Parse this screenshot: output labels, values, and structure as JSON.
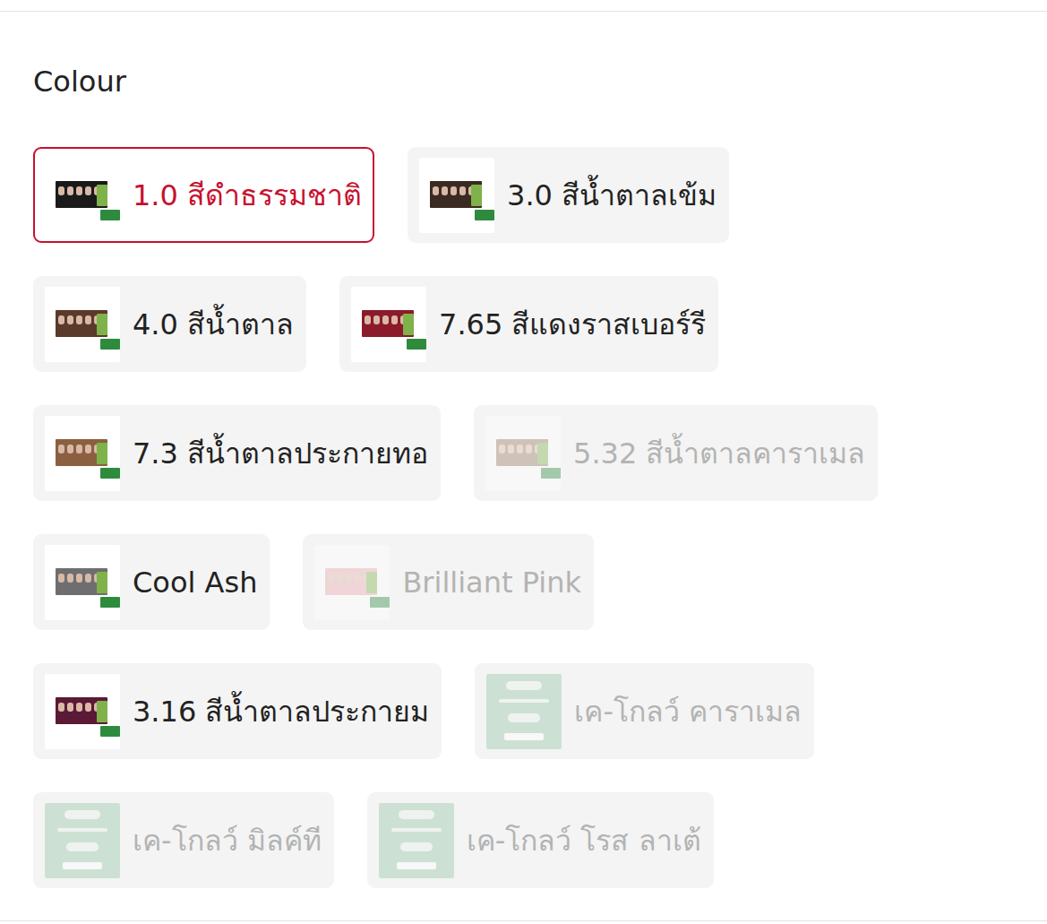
{
  "section": {
    "title": "Colour"
  },
  "options": [
    {
      "label": "1.0 สีดำธรรมชาติ",
      "selected": true,
      "disabled": false,
      "color": "#1a1a1a",
      "kind": "box"
    },
    {
      "label": "3.0 สีน้ำตาลเข้ม",
      "selected": false,
      "disabled": false,
      "color": "#3b2a22",
      "kind": "box"
    },
    {
      "label": "4.0 สีน้ำตาล",
      "selected": false,
      "disabled": false,
      "color": "#5a3a2a",
      "kind": "box"
    },
    {
      "label": "7.65 สีแดงราสเบอร์รี",
      "selected": false,
      "disabled": false,
      "color": "#8b1a2b",
      "kind": "box"
    },
    {
      "label": "7.3 สีน้ำตาลประกายทอ",
      "selected": false,
      "disabled": false,
      "color": "#8a6040",
      "kind": "box"
    },
    {
      "label": "5.32 สีน้ำตาลคาราเมล",
      "selected": false,
      "disabled": true,
      "color": "#9a7a60",
      "kind": "box"
    },
    {
      "label": "Cool Ash",
      "selected": false,
      "disabled": false,
      "color": "#6e6e70",
      "kind": "box"
    },
    {
      "label": "Brilliant Pink",
      "selected": false,
      "disabled": true,
      "color": "#e8a8b0",
      "kind": "box"
    },
    {
      "label": "3.16 สีน้ำตาลประกายม",
      "selected": false,
      "disabled": false,
      "color": "#5a1a35",
      "kind": "box"
    },
    {
      "label": "เค-โกลว์ คาราเมล",
      "selected": false,
      "disabled": true,
      "color": "#93c7a4",
      "kind": "pouch"
    },
    {
      "label": "เค-โกลว์ มิลค์ที",
      "selected": false,
      "disabled": true,
      "color": "#93c7a4",
      "kind": "pouch"
    },
    {
      "label": "เค-โกลว์ โรส ลาเต้",
      "selected": false,
      "disabled": true,
      "color": "#93c7a4",
      "kind": "pouch"
    }
  ]
}
